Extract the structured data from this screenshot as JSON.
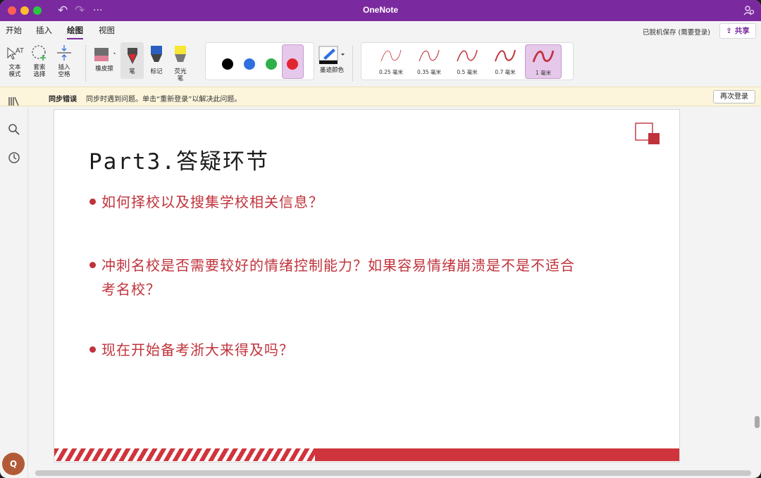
{
  "window": {
    "title": "OneNote"
  },
  "ribbon": {
    "tabs": [
      {
        "label": "开始"
      },
      {
        "label": "插入"
      },
      {
        "label": "绘图"
      },
      {
        "label": "视图"
      }
    ],
    "active_tab": "绘图",
    "offline_status": "已脱机保存 (需要登录)",
    "share_label": "共享"
  },
  "toolbar": {
    "text_mode": "文本\n模式",
    "lasso": "套索\n选择",
    "insert_space": "插入\n空格",
    "eraser": "橡皮擦",
    "pen": "笔",
    "marker": "标记",
    "highlighter": "荧光\n笔",
    "ink_color": "墨迹颜色",
    "colors": [
      "#000000",
      "#2f6fe0",
      "#2fb04a",
      "#e2262f"
    ],
    "selected_color": "#e2262f",
    "widths": [
      {
        "label": "0.25 毫米"
      },
      {
        "label": "0.35 毫米"
      },
      {
        "label": "0.5 毫米"
      },
      {
        "label": "0.7 毫米"
      },
      {
        "label": "1 毫米"
      }
    ],
    "selected_width": "1 毫米"
  },
  "notice": {
    "title": "同步错误",
    "message": "同步时遇到问题。单击“重新登录”以解决此问题。",
    "button": "再次登录"
  },
  "sidebar": {
    "icons": [
      "notebooks-icon",
      "search-icon",
      "recent-icon"
    ],
    "avatar_initial": "Q"
  },
  "slide": {
    "title": "Part3.答疑环节",
    "questions": [
      {
        "line1": "如何择校以及搜集学校相关信息？",
        "line2": ""
      },
      {
        "line1": "冲刺名校是否需要较好的情绪控制能力？如果容易情绪崩溃是不是不适合",
        "line2": "考名校？"
      },
      {
        "line1": "现在开始备考浙大来得及吗？",
        "line2": ""
      }
    ],
    "accent_color": "#c0333b"
  }
}
